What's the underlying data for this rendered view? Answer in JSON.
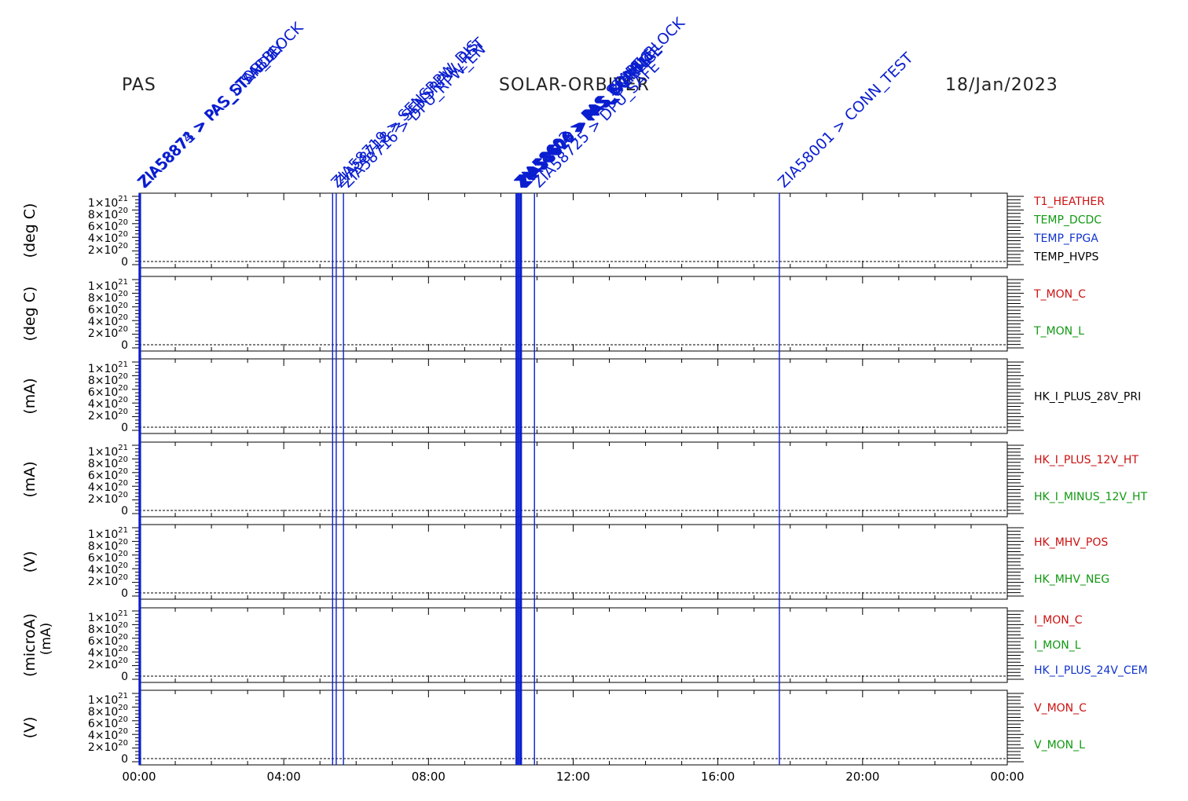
{
  "header": {
    "left": "PAS",
    "center": "SOLAR-ORBITER",
    "date": "18/Jan/2023"
  },
  "colors": {
    "red": "#cc1111",
    "green": "#119911",
    "blue": "#1133cc",
    "black": "#000000",
    "event": "#0a1ed0"
  },
  "chart_data": {
    "type": "line",
    "x": {
      "ticks": [
        "00:00",
        "04:00",
        "08:00",
        "12:00",
        "16:00",
        "20:00",
        "00:00"
      ],
      "range_hours": [
        0,
        24
      ]
    },
    "y_ticks": [
      "0",
      "2x10^20",
      "4x10^20",
      "6x10^20",
      "8x10^20",
      "1x10^21"
    ],
    "y_tick_parts": [
      {
        "mant": "0",
        "exp": ""
      },
      {
        "mant": "2×10",
        "exp": "20"
      },
      {
        "mant": "4×10",
        "exp": "20"
      },
      {
        "mant": "6×10",
        "exp": "20"
      },
      {
        "mant": "8×10",
        "exp": "20"
      },
      {
        "mant": "1×10",
        "exp": "21"
      }
    ],
    "ylim": [
      0,
      1e+21
    ],
    "panels": [
      {
        "ylabel": "(deg C)",
        "series": [
          {
            "name": "T1_HEATHER",
            "color": "red"
          },
          {
            "name": "TEMP_DCDC",
            "color": "green"
          },
          {
            "name": "TEMP_FPGA",
            "color": "blue"
          },
          {
            "name": "TEMP_HVPS",
            "color": "black"
          }
        ]
      },
      {
        "ylabel": "(deg C)",
        "series": [
          {
            "name": "T_MON_C",
            "color": "red"
          },
          {
            "name": "T_MON_L",
            "color": "green"
          }
        ]
      },
      {
        "ylabel": "(mA)",
        "series": [
          {
            "name": "HK_I_PLUS_28V_PRI",
            "color": "black"
          }
        ]
      },
      {
        "ylabel": "(mA)",
        "series": [
          {
            "name": "HK_I_PLUS_12V_HT",
            "color": "red"
          },
          {
            "name": "HK_I_MINUS_12V_HT",
            "color": "green"
          }
        ]
      },
      {
        "ylabel": "(V)",
        "series": [
          {
            "name": "HK_MHV_POS",
            "color": "red"
          },
          {
            "name": "HK_MHV_NEG",
            "color": "green"
          }
        ]
      },
      {
        "ylabel": "(microA)",
        "ylabel2": "(mA)",
        "series": [
          {
            "name": "I_MON_C",
            "color": "red"
          },
          {
            "name": "I_MON_L",
            "color": "green"
          },
          {
            "name": "HK_I_PLUS_24V_CEM",
            "color": "blue"
          }
        ]
      },
      {
        "ylabel": "(V)",
        "series": [
          {
            "name": "V_MON_C",
            "color": "red"
          },
          {
            "name": "V_MON_L",
            "color": "green"
          }
        ]
      }
    ],
    "events": [
      {
        "t": 0.0,
        "label": "ZIA58874 > PAS_STOP_BLOCK"
      },
      {
        "t": 0.02,
        "label": "ZIA58873 > PAS_DISABLE"
      },
      {
        "t": 0.04,
        "label": "ZIA58871 > PAS_STANDBY"
      },
      {
        "t": 5.35,
        "label": "ZIA58719 > SENSRPW_DIS"
      },
      {
        "t": 5.45,
        "label": "ZIA58718 > SENSRPW_RST"
      },
      {
        "t": 5.65,
        "label": "ZIA58716 > DPU_RPW_EN"
      },
      {
        "t": 10.42,
        "label": "ZIA58602 > PAS_START_BLOCK"
      },
      {
        "t": 10.45,
        "label": "ZIA58604 > PAS_CONFIG"
      },
      {
        "t": 10.48,
        "label": "ZIA58606 > PAS_ENABLE"
      },
      {
        "t": 10.51,
        "label": "ZIA58608 > PAS_BURST"
      },
      {
        "t": 10.54,
        "label": "ZIA58610 > PAS_NORMAL"
      },
      {
        "t": 10.57,
        "label": "ZIA58612 > PAS_SCIENCE"
      },
      {
        "t": 10.93,
        "label": "ZIA58725 > DPU_SAFE"
      },
      {
        "t": 17.7,
        "label": "ZIA58001 > CONN_TEST"
      }
    ]
  }
}
